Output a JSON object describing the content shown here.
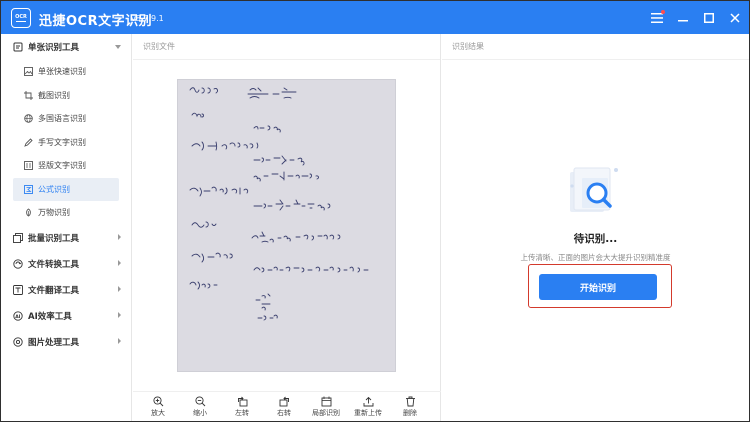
{
  "app": {
    "title": "迅捷OCR文字识别",
    "version": "v8.7.9.1",
    "logo_text": "OCR"
  },
  "sidebar": {
    "groups": [
      {
        "label": "单张识别工具",
        "icon": "single-scan-icon",
        "expanded": true,
        "items": [
          {
            "label": "单张快速识别",
            "icon": "image-icon"
          },
          {
            "label": "截图识别",
            "icon": "crop-icon"
          },
          {
            "label": "多国语言识别",
            "icon": "globe-icon"
          },
          {
            "label": "手写文字识别",
            "icon": "pen-icon"
          },
          {
            "label": "竖版文字识别",
            "icon": "vertical-text-icon"
          },
          {
            "label": "公式识别",
            "icon": "formula-icon",
            "active": true
          },
          {
            "label": "万物识别",
            "icon": "object-icon"
          }
        ]
      },
      {
        "label": "批量识别工具",
        "icon": "batch-icon",
        "expanded": false
      },
      {
        "label": "文件转换工具",
        "icon": "convert-icon",
        "expanded": false
      },
      {
        "label": "文件翻译工具",
        "icon": "translate-icon",
        "expanded": false
      },
      {
        "label": "AI效率工具",
        "icon": "ai-icon",
        "expanded": false
      },
      {
        "label": "图片处理工具",
        "icon": "image-process-icon",
        "expanded": false
      }
    ]
  },
  "left_panel": {
    "header": "识别文件",
    "toolbar": [
      {
        "label": "放大",
        "icon": "zoom-in-icon"
      },
      {
        "label": "缩小",
        "icon": "zoom-out-icon"
      },
      {
        "label": "左转",
        "icon": "rotate-left-icon"
      },
      {
        "label": "右转",
        "icon": "rotate-right-icon"
      },
      {
        "label": "局部识别",
        "icon": "partial-recognize-icon"
      },
      {
        "label": "重新上传",
        "icon": "upload-icon"
      },
      {
        "label": "删除",
        "icon": "delete-icon"
      }
    ]
  },
  "right_panel": {
    "header": "识别结果",
    "status": "待识别...",
    "hint": "上传清晰、正面的图片会大大提升识别精准度",
    "start_button": "开始识别"
  },
  "colors": {
    "brand": "#2a7ff2",
    "highlight_border": "#d33a2c"
  }
}
